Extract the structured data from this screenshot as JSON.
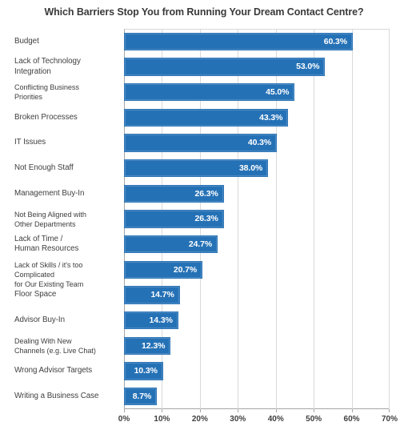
{
  "chart_data": {
    "type": "bar",
    "orientation": "horizontal",
    "title": "Which Barriers Stop You from Running Your Dream Contact Centre?",
    "xlabel": "",
    "ylabel": "",
    "xlim": [
      0,
      70
    ],
    "grid": true,
    "legend": false,
    "accent_color": "#2571b6",
    "border_color": "#2e75b6",
    "value_label_color": "#ffffff",
    "tick_labels": [
      "0%",
      "10%",
      "20%",
      "30%",
      "40%",
      "50%",
      "60%",
      "70%"
    ],
    "tick_values": [
      0,
      10,
      20,
      30,
      40,
      50,
      60,
      70
    ],
    "categories": [
      "Budget",
      "Lack of Technology Integration",
      "Conflicting Business Priorities",
      "Broken Processes",
      "IT Issues",
      "Not Enough Staff",
      "Management Buy-In",
      "Not Being Aligned with Other Departments",
      "Lack of Time / Human Resources",
      "Lack of Skills / it's too Complicated for Our Existing Team",
      "Floor Space",
      "Advisor Buy-In",
      "Dealing With New Channels (e.g. Live Chat)",
      "Wrong Advisor Targets",
      "Writing a Business Case"
    ],
    "category_lines": [
      [
        "Budget"
      ],
      [
        "Lack of Technology",
        "Integration"
      ],
      [
        "Conflicting Business",
        "Priorities"
      ],
      [
        "Broken Processes"
      ],
      [
        "IT Issues"
      ],
      [
        "Not Enough Staff"
      ],
      [
        "Management Buy-In"
      ],
      [
        "Not Being Aligned with",
        "Other Departments"
      ],
      [
        "Lack of Time /",
        "Human Resources"
      ],
      [
        "Lack of Skills / it's too Complicated",
        "for Our Existing Team"
      ],
      [
        "Floor Space"
      ],
      [
        "Advisor Buy-In"
      ],
      [
        "Dealing With New",
        "Channels (e.g. Live Chat)"
      ],
      [
        "Wrong Advisor Targets"
      ],
      [
        "Writing a Business Case"
      ]
    ],
    "values": [
      60.3,
      53.0,
      45.0,
      43.3,
      40.3,
      38.0,
      26.3,
      26.3,
      24.7,
      20.7,
      14.7,
      14.3,
      12.3,
      10.3,
      8.7
    ],
    "value_labels": [
      "60.3%",
      "53.0%",
      "45.0%",
      "43.3%",
      "40.3%",
      "38.0%",
      "26.3%",
      "26.3%",
      "24.7%",
      "20.7%",
      "14.7%",
      "14.3%",
      "12.3%",
      "10.3%",
      "8.7%"
    ]
  }
}
